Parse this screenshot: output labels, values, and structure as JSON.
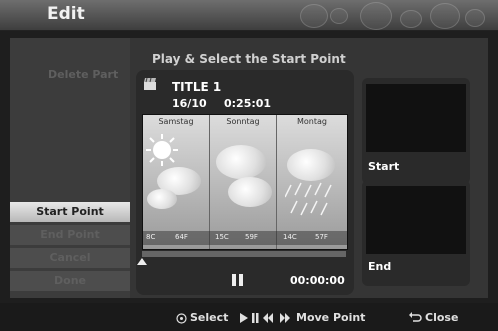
{
  "window": {
    "title": "Edit"
  },
  "sidebar": {
    "items": [
      {
        "label": "Delete Part",
        "state": "dimmed"
      },
      {
        "label": "Start Point",
        "state": "selected"
      },
      {
        "label": "End Point",
        "state": "disabled"
      },
      {
        "label": "Cancel",
        "state": "disabled"
      },
      {
        "label": "Done",
        "state": "disabled"
      }
    ]
  },
  "main": {
    "heading": "Play & Select the Start Point",
    "title_name": "TITLE 1",
    "date": "16/10",
    "duration": "0:25:01",
    "counter": "00:00:00",
    "progress_fraction": 0.0,
    "preview_text": {
      "days": [
        "Samstag",
        "Sonntag",
        "Montag"
      ],
      "temps": [
        "8C",
        "64F",
        "15C",
        "59F",
        "14C",
        "57F"
      ]
    }
  },
  "thumbs": {
    "start_label": "Start",
    "end_label": "End"
  },
  "footer": {
    "select": "Select",
    "move_point": "Move Point",
    "close": "Close"
  },
  "icons": {
    "title": "clapperboard-icon",
    "select": "disc-select-icon",
    "play": "play-icon",
    "pause": "pause-icon",
    "rewind": "rewind-icon",
    "forward": "fast-forward-icon",
    "close": "return-icon"
  }
}
